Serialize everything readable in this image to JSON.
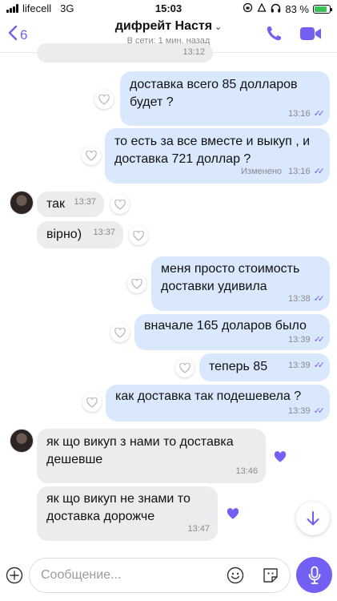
{
  "status_bar": {
    "carrier": "lifecell",
    "network": "3G",
    "time": "15:03",
    "battery": "83 %",
    "battery_level": 0.83
  },
  "header": {
    "back_count": "6",
    "contact_name": "дифрейт Настя",
    "status": "В сети: 1 мин. назад"
  },
  "messages": [
    {
      "time": "13:12"
    },
    {
      "text": "доставка всего 85 долларов будет ?",
      "time": "13:16"
    },
    {
      "text": "то есть за все вместе и выкуп , и доставка  721 доллар ?",
      "edited": "Изменено",
      "time": "13:16"
    },
    {
      "text": "так",
      "time": "13:37"
    },
    {
      "text": "вірно)",
      "time": "13:37"
    },
    {
      "text": "меня просто стоимость доставки удивила",
      "time": "13:38"
    },
    {
      "text": "вначале 165 доларов было",
      "time": "13:39"
    },
    {
      "text": "теперь 85",
      "time": "13:39"
    },
    {
      "text": "как доставка так подешевела ?",
      "time": "13:39"
    },
    {
      "text": "як що викуп з нами то доставка дешевше",
      "time": "13:46"
    },
    {
      "text": "як що викуп не знами то доставка дорожче",
      "time": "13:47"
    }
  ],
  "input": {
    "placeholder": "Сообщение..."
  },
  "colors": {
    "accent": "#7360f2",
    "outgoing_bubble": "#d9e8fd",
    "incoming_bubble": "#ececef"
  },
  "icons": [
    "back-chevron-icon",
    "phone-icon",
    "video-camera-icon",
    "heart-icon",
    "arrow-down-icon",
    "plus-icon",
    "smile-icon",
    "sticker-icon",
    "microphone-icon"
  ]
}
